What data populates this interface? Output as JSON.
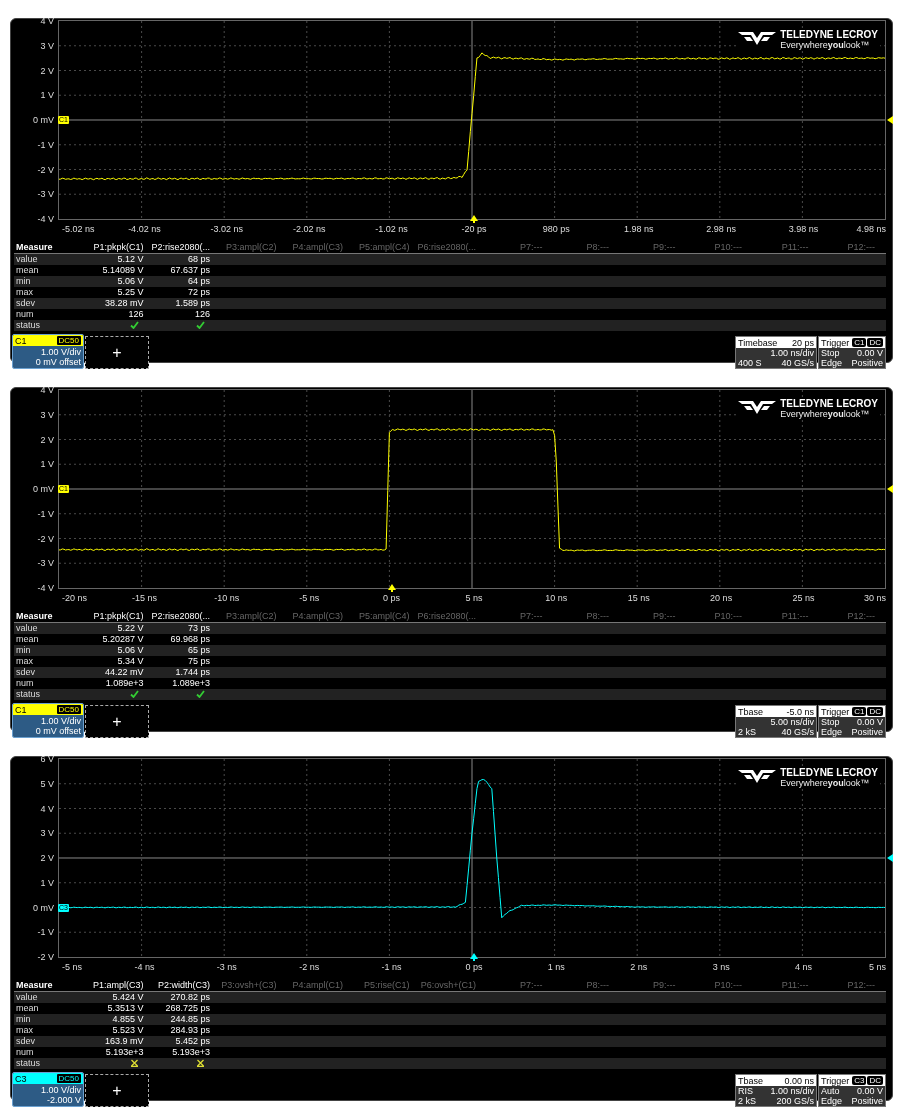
{
  "panels": [
    {
      "trace": {
        "kind": "step"
      },
      "logo": {
        "name": "TELEDYNE LECROY",
        "tagline": "Everywhere**you**look™"
      },
      "y_labels": [
        {
          "text": "4 V",
          "trigger_level": false
        },
        {
          "text": "3 V",
          "trigger_level": false
        },
        {
          "text": "2 V",
          "trigger_level": false
        },
        {
          "text": "1 V",
          "trigger_level": false
        },
        {
          "text": "0 mV",
          "tag": "C1",
          "trigger_level": true
        },
        {
          "text": "-1 V",
          "trigger_level": false
        },
        {
          "text": "-2 V",
          "trigger_level": false
        },
        {
          "text": "-3 V",
          "trigger_level": false
        },
        {
          "text": "-4 V",
          "trigger_level": false
        }
      ],
      "x_labels": [
        {
          "text": "-5.02 ns",
          "trigger": false
        },
        {
          "text": "-4.02 ns",
          "trigger": false
        },
        {
          "text": "-3.02 ns",
          "trigger": false
        },
        {
          "text": "-2.02 ns",
          "trigger": false
        },
        {
          "text": "-1.02 ns",
          "trigger": false
        },
        {
          "text": "-20 ps",
          "trigger": true
        },
        {
          "text": "980 ps",
          "trigger": false
        },
        {
          "text": "1.98 ns",
          "trigger": false
        },
        {
          "text": "2.98 ns",
          "trigger": false
        },
        {
          "text": "3.98 ns",
          "trigger": false
        },
        {
          "text": "4.98 ns",
          "trigger": false
        }
      ],
      "measure": {
        "title": "Measure",
        "row_labels": [
          "value",
          "mean",
          "min",
          "max",
          "sdev",
          "num",
          "status"
        ],
        "columns": [
          {
            "header": "P1:pkpk(C1)",
            "active": true,
            "cells": [
              "5.12 V",
              "5.14089 V",
              "5.06 V",
              "5.25 V",
              "38.28 mV",
              "126"
            ],
            "passed": true
          },
          {
            "header": "P2:rise2080(...",
            "active": true,
            "cells": [
              "68 ps",
              "67.637 ps",
              "64 ps",
              "72 ps",
              "1.589 ps",
              "126"
            ],
            "passed": true
          },
          {
            "header": "P3:ampl(C2)",
            "active": false
          },
          {
            "header": "P4:ampl(C3)",
            "active": false
          },
          {
            "header": "P5:ampl(C4)",
            "active": false
          },
          {
            "header": "P6:rise2080(...",
            "active": false
          },
          {
            "header": "P7:---",
            "active": false
          },
          {
            "header": "P8:---",
            "active": false
          },
          {
            "header": "P9:---",
            "active": false
          },
          {
            "header": "P10:---",
            "active": false
          },
          {
            "header": "P11:---",
            "active": false
          },
          {
            "header": "P12:---",
            "active": false
          }
        ]
      },
      "channel": {
        "name": "C1",
        "coupling": "DC50",
        "scale": "1.00 V/div",
        "offset": "0 mV offset",
        "color": "#ffff00"
      },
      "add_slot": "+",
      "timebase": {
        "label": "Timebase",
        "delay": "20 ps",
        "scale": "1.00 ns/div",
        "samples": "400 S",
        "rate": "40 GS/s"
      },
      "trigger": {
        "label": "Trigger",
        "source": "C1",
        "coupling": "DC",
        "mode": "Stop",
        "level": "0.00 V",
        "type": "Edge",
        "slope": "Positive"
      }
    },
    {
      "trace": {
        "kind": "pulse"
      },
      "logo": {
        "name": "TELEDYNE LECROY",
        "tagline": "Everywhere**you**look™"
      },
      "y_labels": [
        {
          "text": "4 V",
          "trigger_level": false
        },
        {
          "text": "3 V",
          "trigger_level": false
        },
        {
          "text": "2 V",
          "trigger_level": false
        },
        {
          "text": "1 V",
          "trigger_level": false
        },
        {
          "text": "0 mV",
          "tag": "C1",
          "trigger_level": true
        },
        {
          "text": "-1 V",
          "trigger_level": false
        },
        {
          "text": "-2 V",
          "trigger_level": false
        },
        {
          "text": "-3 V",
          "trigger_level": false
        },
        {
          "text": "-4 V",
          "trigger_level": false
        }
      ],
      "x_labels": [
        {
          "text": "-20 ns",
          "trigger": false
        },
        {
          "text": "-15 ns",
          "trigger": false
        },
        {
          "text": "-10 ns",
          "trigger": false
        },
        {
          "text": "-5 ns",
          "trigger": false
        },
        {
          "text": "0 ps",
          "trigger": true
        },
        {
          "text": "5 ns",
          "trigger": false
        },
        {
          "text": "10 ns",
          "trigger": false
        },
        {
          "text": "15 ns",
          "trigger": false
        },
        {
          "text": "20 ns",
          "trigger": false
        },
        {
          "text": "25 ns",
          "trigger": false
        },
        {
          "text": "30 ns",
          "trigger": false
        }
      ],
      "measure": {
        "title": "Measure",
        "row_labels": [
          "value",
          "mean",
          "min",
          "max",
          "sdev",
          "num",
          "status"
        ],
        "columns": [
          {
            "header": "P1:pkpk(C1)",
            "active": true,
            "cells": [
              "5.22 V",
              "5.20287 V",
              "5.06 V",
              "5.34 V",
              "44.22 mV",
              "1.089e+3"
            ],
            "passed": true
          },
          {
            "header": "P2:rise2080(...",
            "active": true,
            "cells": [
              "73 ps",
              "69.968 ps",
              "65 ps",
              "75 ps",
              "1.744 ps",
              "1.089e+3"
            ],
            "passed": true
          },
          {
            "header": "P3:ampl(C2)",
            "active": false
          },
          {
            "header": "P4:ampl(C3)",
            "active": false
          },
          {
            "header": "P5:ampl(C4)",
            "active": false
          },
          {
            "header": "P6:rise2080(...",
            "active": false
          },
          {
            "header": "P7:---",
            "active": false
          },
          {
            "header": "P8:---",
            "active": false
          },
          {
            "header": "P9:---",
            "active": false
          },
          {
            "header": "P10:---",
            "active": false
          },
          {
            "header": "P11:---",
            "active": false
          },
          {
            "header": "P12:---",
            "active": false
          }
        ]
      },
      "channel": {
        "name": "C1",
        "coupling": "DC50",
        "scale": "1.00 V/div",
        "offset": "0 mV offset",
        "color": "#ffff00"
      },
      "add_slot": "+",
      "timebase": {
        "label": "Tbase",
        "delay": "-5.0 ns",
        "scale": "5.00 ns/div",
        "samples": "2 kS",
        "rate": "40 GS/s"
      },
      "trigger": {
        "label": "Trigger",
        "source": "C1",
        "coupling": "DC",
        "mode": "Stop",
        "level": "0.00 V",
        "type": "Edge",
        "slope": "Positive"
      }
    },
    {
      "trace": {
        "kind": "spike"
      },
      "logo": {
        "name": "TELEDYNE LECROY",
        "tagline": "Everywhere**you**look™"
      },
      "y_labels": [
        {
          "text": "6 V",
          "trigger_level": false
        },
        {
          "text": "5 V",
          "trigger_level": false
        },
        {
          "text": "4 V",
          "trigger_level": false
        },
        {
          "text": "3 V",
          "trigger_level": false
        },
        {
          "text": "2 V",
          "trigger_level": true
        },
        {
          "text": "1 V",
          "trigger_level": false
        },
        {
          "text": "0 mV",
          "tag": "C3",
          "trigger_level": false
        },
        {
          "text": "-1 V",
          "trigger_level": false
        },
        {
          "text": "-2 V",
          "trigger_level": false
        }
      ],
      "x_labels": [
        {
          "text": "-5 ns",
          "trigger": false
        },
        {
          "text": "-4 ns",
          "trigger": false
        },
        {
          "text": "-3 ns",
          "trigger": false
        },
        {
          "text": "-2 ns",
          "trigger": false
        },
        {
          "text": "-1 ns",
          "trigger": false
        },
        {
          "text": "0 ps",
          "trigger": true
        },
        {
          "text": "1 ns",
          "trigger": false
        },
        {
          "text": "2 ns",
          "trigger": false
        },
        {
          "text": "3 ns",
          "trigger": false
        },
        {
          "text": "4 ns",
          "trigger": false
        },
        {
          "text": "5 ns",
          "trigger": false
        }
      ],
      "measure": {
        "title": "Measure",
        "row_labels": [
          "value",
          "mean",
          "min",
          "max",
          "sdev",
          "num",
          "status"
        ],
        "columns": [
          {
            "header": "P1:ampl(C3)",
            "active": true,
            "cells": [
              "5.424 V",
              "5.3513 V",
              "4.855 V",
              "5.523 V",
              "163.9 mV",
              "5.193e+3"
            ],
            "passed": false
          },
          {
            "header": "P2:width(C3)",
            "active": true,
            "cells": [
              "270.82 ps",
              "268.725 ps",
              "244.85 ps",
              "284.93 ps",
              "5.452 ps",
              "5.193e+3"
            ],
            "passed": false
          },
          {
            "header": "P3:ovsh+(C3)",
            "active": false
          },
          {
            "header": "P4:ampl(C1)",
            "active": false
          },
          {
            "header": "P5:rise(C1)",
            "active": false
          },
          {
            "header": "P6:ovsh+(C1)",
            "active": false
          },
          {
            "header": "P7:---",
            "active": false
          },
          {
            "header": "P8:---",
            "active": false
          },
          {
            "header": "P9:---",
            "active": false
          },
          {
            "header": "P10:---",
            "active": false
          },
          {
            "header": "P11:---",
            "active": false
          },
          {
            "header": "P12:---",
            "active": false
          }
        ]
      },
      "channel": {
        "name": "C3",
        "coupling": "DC50",
        "scale": "1.00 V/div",
        "offset": "-2.000 V",
        "color": "#00ffff"
      },
      "add_slot": "+",
      "timebase": {
        "label": "Tbase",
        "delay": "0.00 ns",
        "mode": "RIS",
        "scale": "1.00 ns/div",
        "samples": "2 kS",
        "rate": "200 GS/s"
      },
      "trigger": {
        "label": "Trigger",
        "source": "C3",
        "coupling": "DC",
        "mode": "Auto",
        "level": "0.00 V",
        "type": "Edge",
        "slope": "Positive"
      }
    }
  ]
}
